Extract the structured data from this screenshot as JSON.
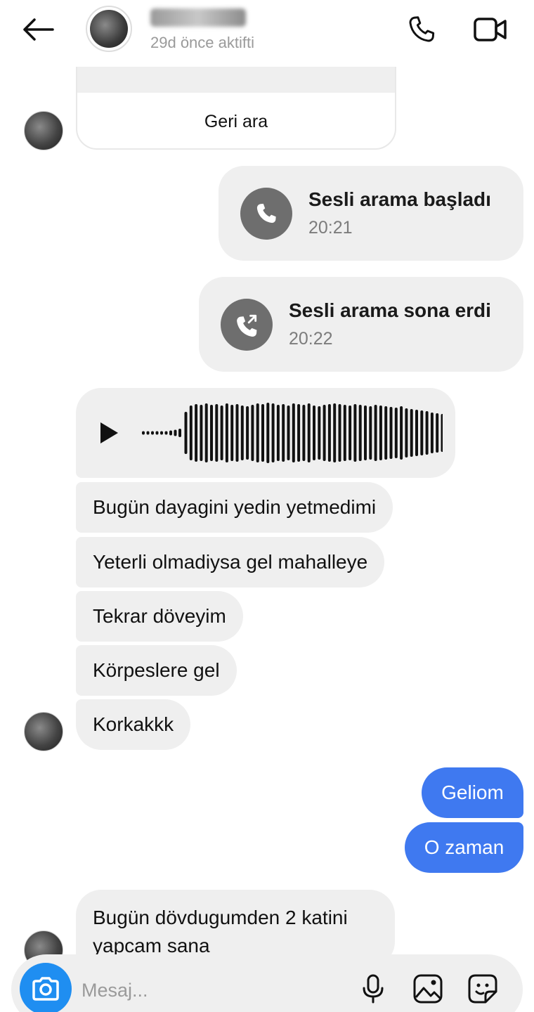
{
  "header": {
    "contact_name": "",
    "status": "29d önce aktifti"
  },
  "missed_call": {
    "callback_label": "Geri ara"
  },
  "calls": [
    {
      "title": "Sesli arama başladı",
      "time": "20:21"
    },
    {
      "title": "Sesli arama sona erdi",
      "time": "20:22"
    }
  ],
  "messages": {
    "received_1": "Bugün dayagini yedin yetmedimi",
    "received_2": "Yeterli olmadiysa gel mahalleye",
    "received_3": "Tekrar döveyim",
    "received_4": "Körpeslere gel",
    "received_5": "Korkakkk",
    "sent_1": "Geliom",
    "sent_2": "O zaman",
    "received_6": "Bugün dövdugumden 2 katini yapcam sana"
  },
  "composer": {
    "placeholder": "Mesaj..."
  },
  "colors": {
    "sent_bubble": "#3f79f0",
    "received_bubble": "#efefef",
    "camera_button": "#1f8ef1",
    "missed_call_red": "#e23b4e"
  },
  "icons": [
    "back-arrow-icon",
    "phone-icon",
    "video-camera-icon",
    "play-icon",
    "camera-icon",
    "microphone-icon",
    "image-icon",
    "sticker-icon"
  ]
}
